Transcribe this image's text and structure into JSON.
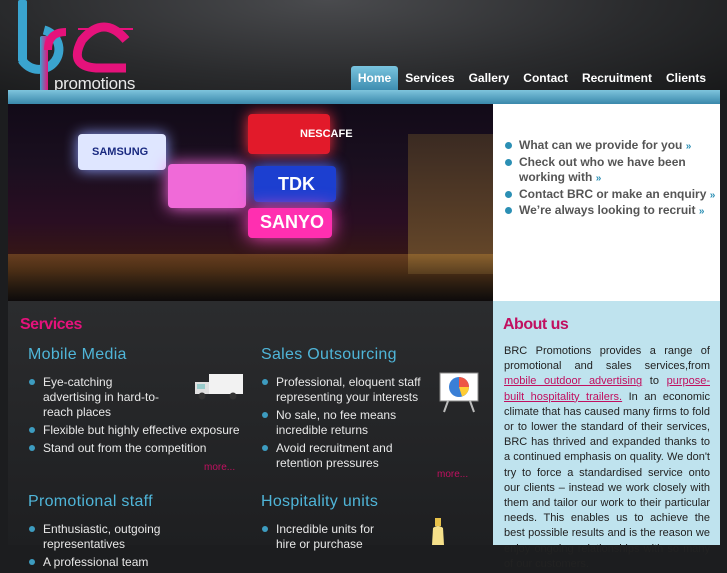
{
  "logo": {
    "wordmark": "promotions"
  },
  "nav": {
    "items": [
      "Home",
      "Services",
      "Gallery",
      "Contact",
      "Recruitment",
      "Clients"
    ]
  },
  "hero": {
    "signs": [
      "SAMSUNG",
      "NESCAFE",
      "TDK",
      "SANYO"
    ]
  },
  "quick_links": [
    {
      "text": "What can we provide for you"
    },
    {
      "text": "Check out who we have been working with"
    },
    {
      "text": "Contact BRC or make an enquiry"
    },
    {
      "text": "We’re always looking to recruit"
    }
  ],
  "services": {
    "title": "Services",
    "more_label": "more...",
    "blocks": [
      {
        "title": "Mobile Media",
        "items": [
          "Eye-catching advertising in hard-to-reach places",
          "Flexible but highly effective exposure",
          "Stand out from the competition"
        ]
      },
      {
        "title": "Sales Outsourcing",
        "items": [
          "Professional, eloquent staff representing your interests",
          "No sale, no fee means incredible returns",
          "Avoid recruitment and retention pressures"
        ]
      },
      {
        "title": "Promotional staff",
        "items": [
          "Enthusiastic, outgoing representatives",
          "A professional team"
        ]
      },
      {
        "title": "Hospitality units",
        "items": [
          "Incredible units for hire or purchase"
        ]
      }
    ]
  },
  "about": {
    "title": "About us",
    "text_1": "BRC Promotions provides a range of promotional and sales services,from",
    "link_1": "mobile outdoor advertising",
    "text_2": "to",
    "link_2": "purpose-built hospitality trailers.",
    "text_3": "In an economic climate that has caused many firms to fold or to lower the standard of their services, BRC has thrived and expanded thanks to a continued emphasis on quality. We don't try to force a standardised service onto our clients – instead we work closely with them and tailor our work to their particular needs. This enables us to achieve the best possible results and is the reason we enjoy ongoing relationships with so many of our customers."
  },
  "colors": {
    "accent_pink": "#e5127b",
    "accent_blue": "#4fb5d8",
    "nav_blue": "#3e8db0"
  },
  "icons": {
    "quick_link_arrow": "double-chevron-right-icon",
    "bullet": "round-bullet-icon"
  }
}
